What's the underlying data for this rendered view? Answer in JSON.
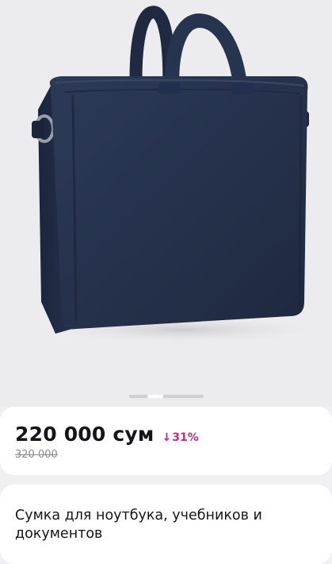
{
  "product": {
    "image_alt": "Сумка для ноутбука, учебников и документов",
    "gallery": {
      "total_slides": 3,
      "active_slide": 2
    },
    "price": "220 000 сум",
    "discount_arrow": "↓",
    "discount": "31%",
    "old_price": "320 000",
    "title": "Сумка для ноутбука, учебников и документов"
  },
  "colors": {
    "background": "#f0f0f2",
    "bag": "#27344f",
    "discount": "#d4237c",
    "price_text": "#15151a",
    "old_price_text": "#8a8a90"
  }
}
